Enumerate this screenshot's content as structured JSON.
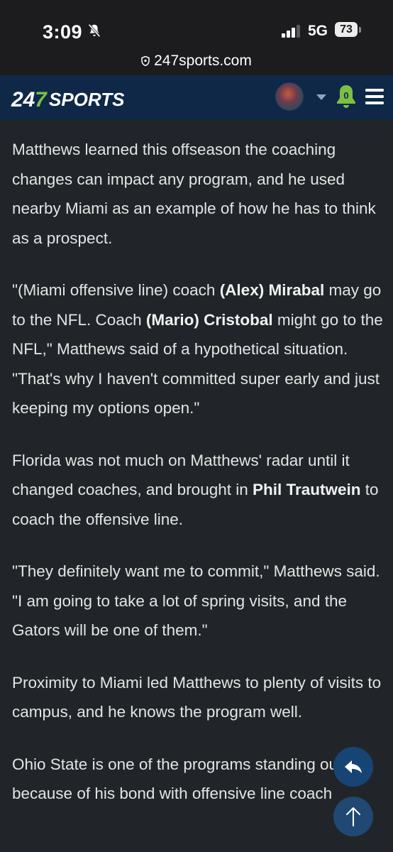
{
  "status_bar": {
    "time": "3:09",
    "network": "5G",
    "battery": "73"
  },
  "browser": {
    "url": "247sports.com"
  },
  "header": {
    "logo_text": "247SPORTS",
    "notification_count": "0",
    "colors": {
      "header_bg": "#0f2848",
      "accent_green": "#7bc043"
    }
  },
  "article": {
    "p1": "Matthews learned this offseason the coaching changes can impact any program, and he used nearby Miami as an example of how he has to think as a prospect.",
    "p2": {
      "t1": "\"(Miami offensive line) coach ",
      "b1": "(Alex) Mirabal",
      "t2": " may go to the NFL. Coach ",
      "b2": "(Mario) Cristobal",
      "t3": " might go to the NFL,\" Matthews said of a hypothetical situation. \"That's why I haven't committed super early and just keeping my options open.\""
    },
    "p3": {
      "t1": "Florida was not much on Matthews' radar until it changed coaches, and brought in ",
      "b1": "Phil Trautwein",
      "t2": " to coach the offensive line."
    },
    "p4": "\"They definitely want me to commit,\" Matthews said. \"I am going to take a lot of spring visits, and the Gators will be one of them.\"",
    "p5": "Proximity to Miami led Matthews to plenty of visits to campus, and he knows the program well.",
    "p6": "Ohio State is one of the programs standing out because of his bond with offensive line coach"
  },
  "icons": [
    "bell-off-icon",
    "signal-icon",
    "battery-icon",
    "lock-icon",
    "avatar",
    "caret-down-icon",
    "bell-icon",
    "menu-icon",
    "share-icon",
    "arrow-up-icon"
  ]
}
